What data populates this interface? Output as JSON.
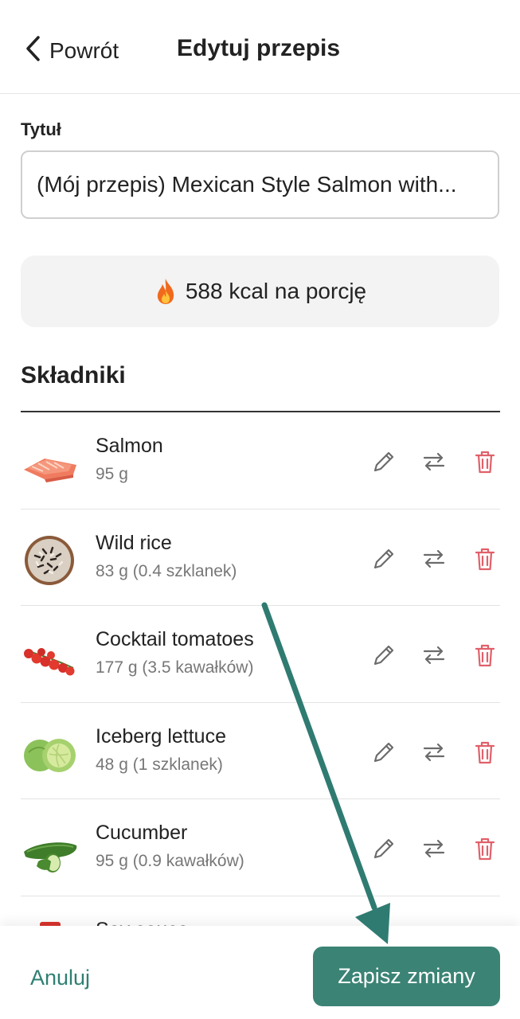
{
  "header": {
    "back_label": "Powrót",
    "title": "Edytuj przepis"
  },
  "form": {
    "title_label": "Tytuł",
    "title_value": "(Mój przepis) Mexican Style Salmon with..."
  },
  "calories": {
    "text": "588 kcal na porcję",
    "icon": "fire-icon"
  },
  "ingredients_section": {
    "title": "Składniki",
    "items": [
      {
        "name": "Salmon",
        "qty": "95 g",
        "image": "salmon-image"
      },
      {
        "name": "Wild rice",
        "qty": "83 g (0.4 szklanek)",
        "image": "wild-rice-image"
      },
      {
        "name": "Cocktail tomatoes",
        "qty": "177 g (3.5 kawałków)",
        "image": "cocktail-tomatoes-image"
      },
      {
        "name": "Iceberg lettuce",
        "qty": "48 g (1 szklanek)",
        "image": "iceberg-lettuce-image"
      },
      {
        "name": "Cucumber",
        "qty": "95 g (0.9 kawałków)",
        "image": "cucumber-image"
      }
    ],
    "partial_item_name": "Soy sauce"
  },
  "footer": {
    "cancel_label": "Anuluj",
    "save_label": "Zapisz zmiany"
  },
  "colors": {
    "accent": "#3b8375",
    "delete": "#e0606a",
    "icon_gray": "#6b6b6b"
  }
}
